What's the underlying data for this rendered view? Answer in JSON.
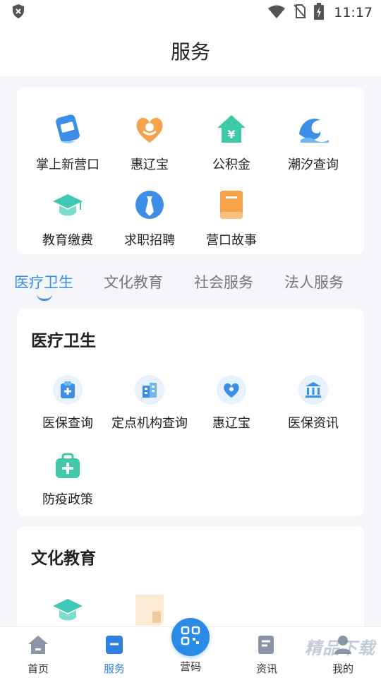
{
  "status_bar": {
    "time": "11:17"
  },
  "header": {
    "title": "服务"
  },
  "quick_services": [
    {
      "label": "掌上新营口",
      "icon": "card-icon"
    },
    {
      "label": "惠辽宝",
      "icon": "heart-hands-icon"
    },
    {
      "label": "公积金",
      "icon": "house-yen-icon"
    },
    {
      "label": "潮汐查询",
      "icon": "wave-icon"
    },
    {
      "label": "教育缴费",
      "icon": "graduation-cap-icon"
    },
    {
      "label": "求职招聘",
      "icon": "tie-icon"
    },
    {
      "label": "营口故事",
      "icon": "book-icon"
    }
  ],
  "tabs": [
    {
      "label": "医疗卫生",
      "active": true
    },
    {
      "label": "文化教育",
      "active": false
    },
    {
      "label": "社会服务",
      "active": false
    },
    {
      "label": "法人服务",
      "active": false
    }
  ],
  "medical": {
    "title": "医疗卫生",
    "items": [
      {
        "label": "医保查询",
        "icon": "medical-board-icon"
      },
      {
        "label": "定点机构查询",
        "icon": "building-icon"
      },
      {
        "label": "惠辽宝",
        "icon": "heart-hands-icon"
      },
      {
        "label": "医保资讯",
        "icon": "bank-icon"
      },
      {
        "label": "防疫政策",
        "icon": "first-aid-kit-icon"
      }
    ]
  },
  "education": {
    "title": "文化教育"
  },
  "bottom_nav": {
    "home": "首页",
    "service": "服务",
    "code": "营码",
    "news": "资讯",
    "mine": "我的"
  },
  "watermark": "精品下载",
  "colors": {
    "accent": "#3d8ee6",
    "teal": "#3fc9b5",
    "orange": "#f5a24b"
  }
}
